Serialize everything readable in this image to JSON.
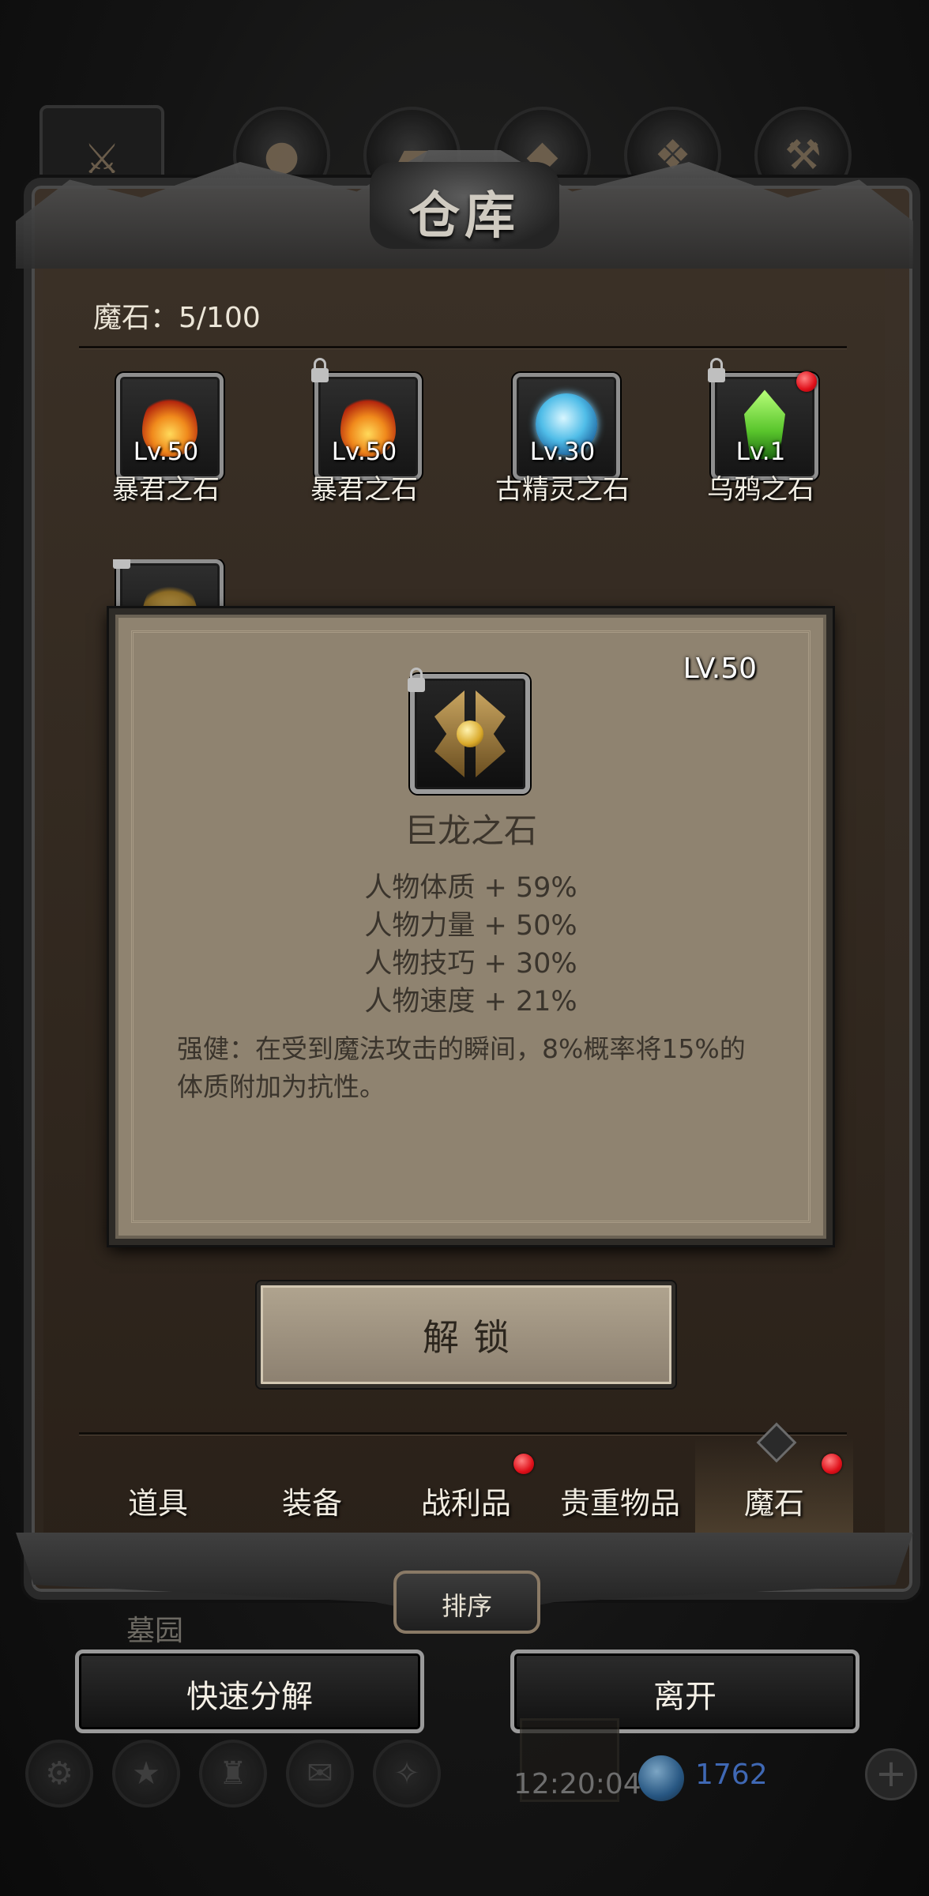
{
  "window": {
    "title": "仓库"
  },
  "stone_count": "魔石：5/100",
  "stones": [
    {
      "level": "Lv.50",
      "name": "暴君之石",
      "gem": "fire-stone-icon",
      "locked": false,
      "badge": false
    },
    {
      "level": "Lv.50",
      "name": "暴君之石",
      "gem": "fire-stone-icon",
      "locked": true,
      "badge": false
    },
    {
      "level": "Lv.30",
      "name": "古精灵之石",
      "gem": "blue-orb-icon",
      "locked": false,
      "badge": false
    },
    {
      "level": "Lv.1",
      "name": "乌鸦之石",
      "gem": "green-crystal-icon",
      "locked": true,
      "badge": true
    }
  ],
  "popup": {
    "level": "LV.50",
    "name": "巨龙之石",
    "icon": "dragon-stone-icon",
    "attributes": [
      "人物体质 + 59%",
      "人物力量 + 50%",
      "人物技巧 + 30%",
      "人物速度 + 21%"
    ],
    "description": "强健：在受到魔法攻击的瞬间，8%概率将15%的体质附加为抗性。"
  },
  "unlock_button": "解锁",
  "categories": [
    {
      "label": "道具",
      "badge": false,
      "active": false
    },
    {
      "label": "装备",
      "badge": false,
      "active": false
    },
    {
      "label": "战利品",
      "badge": true,
      "active": false
    },
    {
      "label": "贵重物品",
      "badge": false,
      "active": false
    },
    {
      "label": "魔石",
      "badge": true,
      "active": true
    }
  ],
  "sort_button": "排序",
  "background_label": "墓园",
  "quick_dismantle_button": "快速分解",
  "leave_button": "离开",
  "hud": {
    "time": "12:20:04",
    "currency": "1762"
  },
  "colors": {
    "badge_red": "#e0101a",
    "panel_parchment": "#8f8370",
    "text_light": "#f2eee4"
  }
}
